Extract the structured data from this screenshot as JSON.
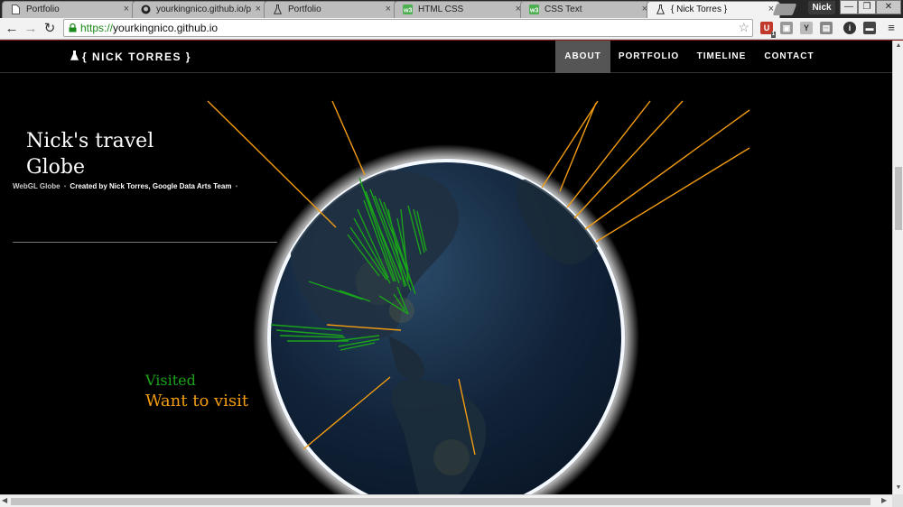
{
  "browser": {
    "tabs": [
      {
        "label": "Portfolio",
        "icon": "page-icon",
        "active": false
      },
      {
        "label": "yourkingnico.github.io/p",
        "icon": "github-icon",
        "active": false
      },
      {
        "label": "Portfolio",
        "icon": "flask-icon",
        "active": false
      },
      {
        "label": "HTML CSS",
        "icon": "w3-icon",
        "active": false
      },
      {
        "label": "CSS Text",
        "icon": "w3-icon",
        "active": false
      },
      {
        "label": "{ Nick Torres }",
        "icon": "flask-icon",
        "active": true
      }
    ],
    "profile_name": "Nick",
    "url_scheme": "https://",
    "url_host": "yourkingnico.github.io",
    "ext_badge": "1",
    "colors": {
      "url_green": "#1a8a1a",
      "tab_active": "#f2f2f2",
      "tab_inactive": "#bdbdbd"
    }
  },
  "site": {
    "brand": "{ NICK TORRES }",
    "nav": [
      {
        "label": "ABOUT",
        "active": true
      },
      {
        "label": "PORTFOLIO",
        "active": false
      },
      {
        "label": "TIMELINE",
        "active": false
      },
      {
        "label": "CONTACT",
        "active": false
      }
    ]
  },
  "main": {
    "title_line1": "Nick's travel",
    "title_line2": "Globe",
    "webgl_label": "WebGL Globe",
    "credit": "Created by Nick Torres, Google Data Arts Team",
    "legend": {
      "visited": "Visited",
      "want": "Want to visit"
    },
    "colors": {
      "visited": "#1aa31a",
      "want": "#f39c12",
      "globe_ocean": "#0d1b2e"
    }
  }
}
